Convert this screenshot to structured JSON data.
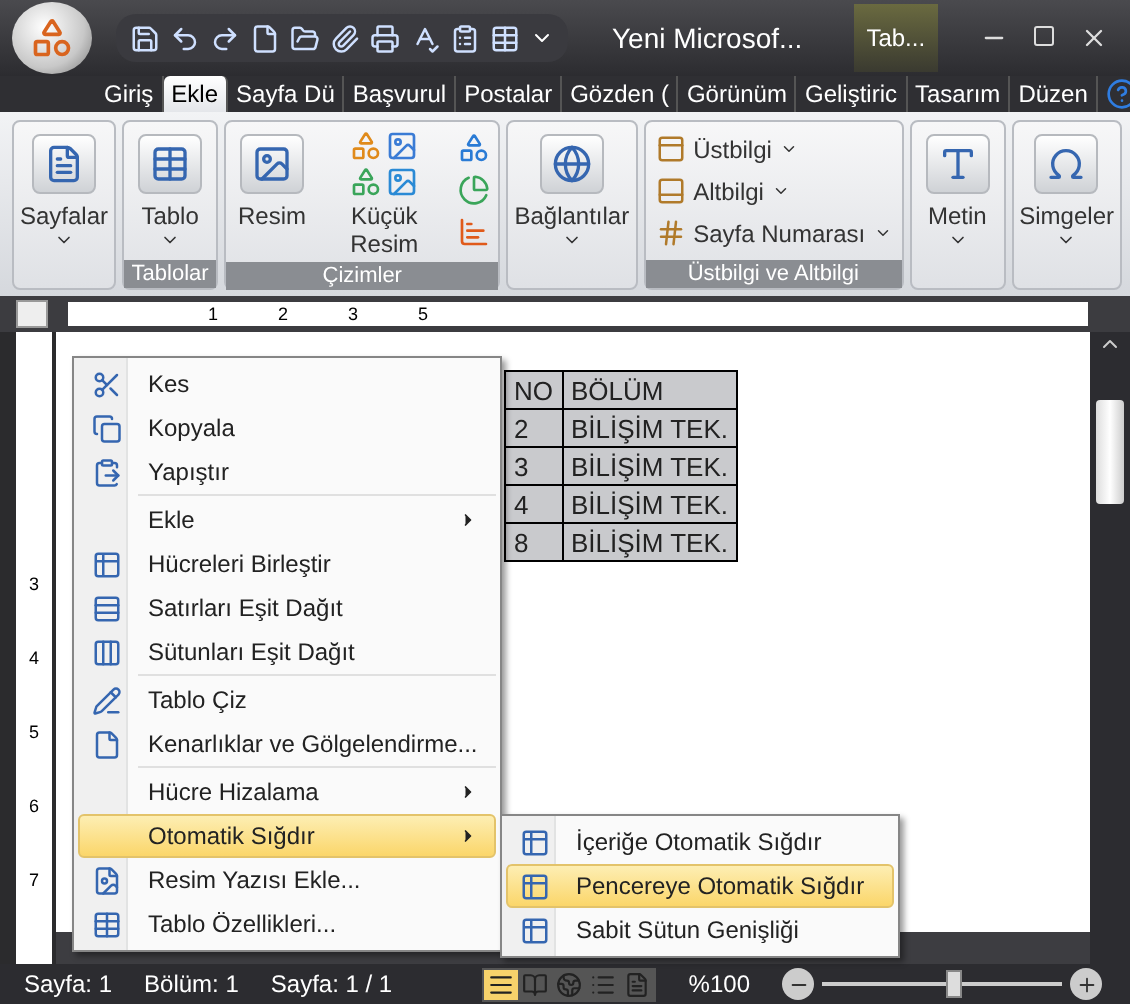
{
  "window": {
    "title": "Yeni Microsof...",
    "context_tab": "Tab..."
  },
  "tabs": [
    {
      "label": "Giriş",
      "selected": false
    },
    {
      "label": "Ekle",
      "selected": true
    },
    {
      "label": "Sayfa Dü",
      "selected": false
    },
    {
      "label": "Başvurul",
      "selected": false
    },
    {
      "label": "Postalar",
      "selected": false
    },
    {
      "label": "Gözden (",
      "selected": false
    },
    {
      "label": "Görünüm",
      "selected": false
    },
    {
      "label": "Geliştiric",
      "selected": false
    },
    {
      "label": "Tasarım",
      "selected": false
    },
    {
      "label": "Düzen",
      "selected": false
    }
  ],
  "ribbon_groups": [
    {
      "items": [
        {
          "kind": "large",
          "label": "Sayfalar",
          "dropdown": true
        }
      ]
    },
    {
      "label": "Tablolar",
      "items": [
        {
          "kind": "large",
          "label": "Tablo",
          "dropdown": true
        }
      ]
    },
    {
      "label": "Çizimler",
      "items": [
        {
          "kind": "large",
          "label": "Resim",
          "dropdown": false
        },
        {
          "kind": "grid",
          "label": "Küçük Resim"
        },
        {
          "kind": "column"
        }
      ]
    },
    {
      "items": [
        {
          "kind": "large",
          "label": "Bağlantılar",
          "dropdown": true
        }
      ]
    },
    {
      "label": "Üstbilgi ve Altbilgi",
      "items": [
        {
          "kind": "list",
          "rows": [
            {
              "label": "Üstbilgi"
            },
            {
              "label": "Altbilgi"
            },
            {
              "label": "Sayfa Numarası"
            }
          ]
        }
      ]
    },
    {
      "items": [
        {
          "kind": "large",
          "label": "Metin",
          "dropdown": true
        }
      ]
    },
    {
      "items": [
        {
          "kind": "large",
          "label": "Simgeler",
          "dropdown": true
        }
      ]
    }
  ],
  "ruler": {
    "marks": [
      "1",
      "2",
      "3",
      "5"
    ]
  },
  "vertical_ruler": {
    "marks": [
      "3",
      "4",
      "5",
      "6",
      "7"
    ]
  },
  "table": {
    "columns": [
      "NO",
      "BÖLÜM"
    ],
    "rows": [
      [
        "2",
        "BİLİŞİM TEK."
      ],
      [
        "3",
        "BİLİŞİM TEK."
      ],
      [
        "4",
        "BİLİŞİM TEK."
      ],
      [
        "8",
        "BİLİŞİM TEK."
      ]
    ]
  },
  "context_menu": {
    "items": [
      {
        "kind": "item",
        "label": "Kes",
        "submenu": false,
        "selected": false
      },
      {
        "kind": "item",
        "label": "Kopyala",
        "submenu": false,
        "selected": false
      },
      {
        "kind": "item",
        "label": "Yapıştır",
        "submenu": false,
        "selected": false
      },
      {
        "kind": "separator"
      },
      {
        "kind": "item",
        "label": "Ekle",
        "submenu": true,
        "selected": false
      },
      {
        "kind": "item",
        "label": "Hücreleri Birleştir",
        "submenu": false,
        "selected": false
      },
      {
        "kind": "item",
        "label": "Satırları Eşit Dağıt",
        "submenu": false,
        "selected": false
      },
      {
        "kind": "item",
        "label": "Sütunları Eşit Dağıt",
        "submenu": false,
        "selected": false
      },
      {
        "kind": "separator"
      },
      {
        "kind": "item",
        "label": "Tablo Çiz",
        "submenu": false,
        "selected": false
      },
      {
        "kind": "item",
        "label": "Kenarlıklar ve Gölgelendirme...",
        "submenu": false,
        "selected": false
      },
      {
        "kind": "separator"
      },
      {
        "kind": "item",
        "label": "Hücre Hizalama",
        "submenu": true,
        "selected": false
      },
      {
        "kind": "item",
        "label": "Otomatik Sığdır",
        "submenu": true,
        "selected": true
      },
      {
        "kind": "item",
        "label": "Resim Yazısı Ekle...",
        "submenu": false,
        "selected": false
      },
      {
        "kind": "item",
        "label": "Tablo Özellikleri...",
        "submenu": false,
        "selected": false
      }
    ]
  },
  "submenu": {
    "items": [
      {
        "label": "İçeriğe Otomatik Sığdır",
        "selected": false
      },
      {
        "label": "Pencereye Otomatik Sığdır",
        "selected": true
      },
      {
        "label": "Sabit Sütun Genişliği",
        "selected": false
      }
    ]
  },
  "status_bar": {
    "fields": [
      "Sayfa: 1",
      "Bölüm: 1",
      "Sayfa: 1 / 1"
    ],
    "views": [
      {
        "selected": true
      },
      {
        "selected": false
      },
      {
        "selected": false
      },
      {
        "selected": false
      },
      {
        "selected": false
      }
    ],
    "zoom_label": "%100",
    "zoom": {
      "level": 0.55
    }
  }
}
